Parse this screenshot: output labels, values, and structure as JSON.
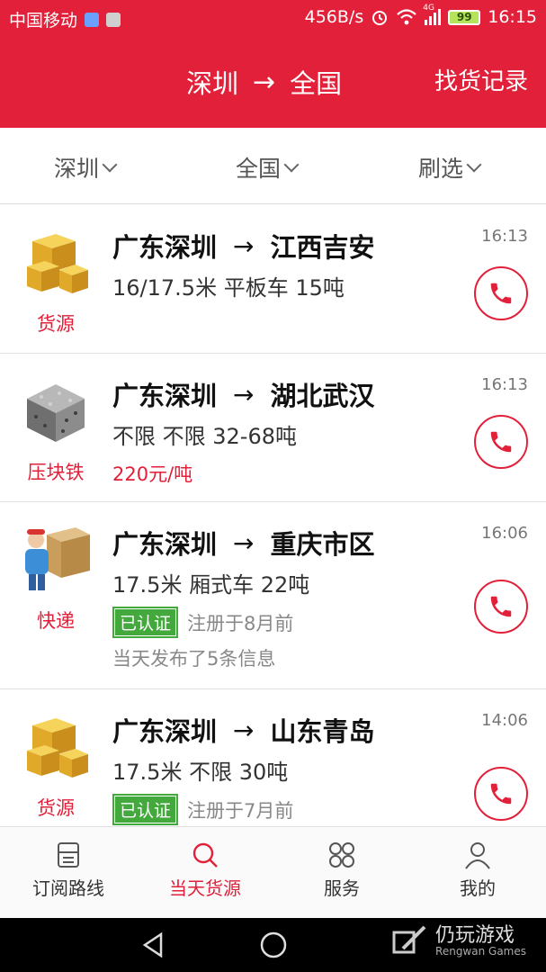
{
  "status_bar": {
    "carrier": "中国移动",
    "net_speed": "456B/s",
    "signal_type": "4G",
    "battery": "99",
    "time": "16:15"
  },
  "header": {
    "from": "深圳",
    "arrow": "→",
    "to": "全国",
    "history_label": "找货记录"
  },
  "filters": [
    {
      "label": "深圳"
    },
    {
      "label": "全国"
    },
    {
      "label": "刷选"
    }
  ],
  "listings": [
    {
      "category": "货源",
      "icon": "boxes-icon",
      "from": "广东深圳",
      "to": "江西吉安",
      "detail": "16/17.5米 平板车 15吨",
      "time": "16:13"
    },
    {
      "category": "压块铁",
      "icon": "iron-block-icon",
      "from": "广东深圳",
      "to": "湖北武汉",
      "detail": "不限 不限 32-68吨",
      "price": "220元/吨",
      "time": "16:13"
    },
    {
      "category": "快递",
      "icon": "courier-icon",
      "from": "广东深圳",
      "to": "重庆市区",
      "detail": "17.5米 厢式车 22吨",
      "badge": "已认证",
      "registered": "注册于8月前",
      "posted": "当天发布了5条信息",
      "time": "16:06"
    },
    {
      "category": "货源",
      "icon": "boxes-icon",
      "from": "广东深圳",
      "to": "山东青岛",
      "detail": "17.5米 不限 30吨",
      "badge": "已认证",
      "registered": "注册于7月前",
      "time": "14:06"
    }
  ],
  "bottom_nav": [
    {
      "label": "订阅路线",
      "icon": "subscribe-route-icon"
    },
    {
      "label": "当天货源",
      "icon": "search-icon",
      "active": true
    },
    {
      "label": "服务",
      "icon": "services-grid-icon"
    },
    {
      "label": "我的",
      "icon": "profile-icon"
    }
  ],
  "watermark": {
    "main": "仍玩游戏",
    "sub": "Rengwan Games"
  },
  "colors": {
    "brand_red": "#e2203a",
    "verified_green": "#43a93d"
  }
}
